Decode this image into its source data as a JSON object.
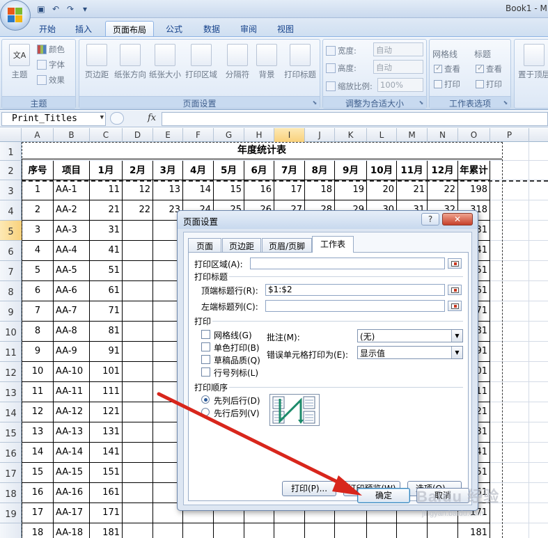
{
  "app": {
    "window_title": "Book1 - M",
    "qat": [
      "save-icon",
      "undo-icon",
      "redo-icon",
      "customize-icon"
    ]
  },
  "ribbon": {
    "tabs": [
      "开始",
      "插入",
      "页面布局",
      "公式",
      "数据",
      "审阅",
      "视图"
    ],
    "active_tab": "页面布局",
    "themes": {
      "label": "主题",
      "main": "主题",
      "colors": "颜色",
      "fonts": "字体",
      "effects": "效果"
    },
    "page_setup": {
      "label": "页面设置",
      "margins": "页边距",
      "orientation": "纸张方向",
      "size": "纸张大小",
      "print_area": "打印区域",
      "breaks": "分隔符",
      "background": "背景",
      "print_titles": "打印标题"
    },
    "scale_to_fit": {
      "label": "调整为合适大小",
      "width_label": "宽度:",
      "width_value": "自动",
      "height_label": "高度:",
      "height_value": "自动",
      "scale_label": "缩放比例:",
      "scale_value": "100%"
    },
    "sheet_options": {
      "label": "工作表选项",
      "gridlines": "网格线",
      "headings": "标题",
      "view": "查看",
      "print": "打印"
    },
    "arrange": {
      "bring_forward": "置于顶层"
    }
  },
  "formula_bar": {
    "name_box": "Print_Titles",
    "fx": "fx",
    "formula": ""
  },
  "sheet": {
    "columns": [
      "A",
      "B",
      "C",
      "D",
      "E",
      "F",
      "G",
      "H",
      "I",
      "J",
      "K",
      "L",
      "M",
      "N",
      "O",
      "P"
    ],
    "selected_column": "I",
    "rows": [
      "1",
      "2",
      "3",
      "4",
      "5",
      "6",
      "7",
      "8",
      "9",
      "10",
      "11",
      "12",
      "13",
      "14",
      "15",
      "16",
      "17",
      "18",
      "19"
    ],
    "selected_row": "5",
    "title": "年度统计表",
    "header": [
      "序号",
      "项目",
      "1月",
      "2月",
      "3月",
      "4月",
      "5月",
      "6月",
      "7月",
      "8月",
      "9月",
      "10月",
      "11月",
      "12月",
      "年累计"
    ],
    "data": [
      [
        "1",
        "AA-1",
        "11",
        "12",
        "13",
        "14",
        "15",
        "16",
        "17",
        "18",
        "19",
        "20",
        "21",
        "22",
        "198"
      ],
      [
        "2",
        "AA-2",
        "21",
        "22",
        "23",
        "24",
        "25",
        "26",
        "27",
        "28",
        "29",
        "30",
        "31",
        "32",
        "318"
      ],
      [
        "3",
        "AA-3",
        "31",
        "",
        "",
        "",
        "",
        "",
        "",
        "",
        "",
        "",
        "",
        "",
        "31"
      ],
      [
        "4",
        "AA-4",
        "41",
        "",
        "",
        "",
        "",
        "",
        "",
        "",
        "",
        "",
        "",
        "",
        "41"
      ],
      [
        "5",
        "AA-5",
        "51",
        "",
        "",
        "",
        "",
        "",
        "",
        "",
        "",
        "",
        "",
        "",
        "51"
      ],
      [
        "6",
        "AA-6",
        "61",
        "",
        "",
        "",
        "",
        "",
        "",
        "",
        "",
        "",
        "",
        "",
        "61"
      ],
      [
        "7",
        "AA-7",
        "71",
        "",
        "",
        "",
        "",
        "",
        "",
        "",
        "",
        "",
        "",
        "",
        "71"
      ],
      [
        "8",
        "AA-8",
        "81",
        "",
        "",
        "",
        "",
        "",
        "",
        "",
        "",
        "",
        "",
        "",
        "81"
      ],
      [
        "9",
        "AA-9",
        "91",
        "",
        "",
        "",
        "",
        "",
        "",
        "",
        "",
        "",
        "",
        "",
        "91"
      ],
      [
        "10",
        "AA-10",
        "101",
        "",
        "",
        "",
        "",
        "",
        "",
        "",
        "",
        "",
        "",
        "",
        "101"
      ],
      [
        "11",
        "AA-11",
        "111",
        "",
        "",
        "",
        "",
        "",
        "",
        "",
        "",
        "",
        "",
        "",
        "111"
      ],
      [
        "12",
        "AA-12",
        "121",
        "",
        "",
        "",
        "",
        "",
        "",
        "",
        "",
        "",
        "",
        "",
        "121"
      ],
      [
        "13",
        "AA-13",
        "131",
        "",
        "",
        "",
        "",
        "",
        "",
        "",
        "",
        "",
        "",
        "",
        "131"
      ],
      [
        "14",
        "AA-14",
        "141",
        "",
        "",
        "",
        "",
        "",
        "",
        "",
        "",
        "",
        "",
        "",
        "141"
      ],
      [
        "15",
        "AA-15",
        "151",
        "",
        "",
        "",
        "",
        "",
        "",
        "",
        "",
        "",
        "",
        "",
        "151"
      ],
      [
        "16",
        "AA-16",
        "161",
        "",
        "",
        "",
        "",
        "",
        "",
        "",
        "",
        "",
        "",
        "",
        "161"
      ],
      [
        "17",
        "AA-17",
        "171",
        "",
        "",
        "",
        "",
        "",
        "",
        "",
        "",
        "",
        "",
        "",
        "171"
      ],
      [
        "18",
        "AA-18",
        "181",
        "",
        "",
        "",
        "",
        "",
        "",
        "",
        "",
        "",
        "",
        "",
        "181"
      ]
    ]
  },
  "dialog": {
    "title": "页面设置",
    "help": "?",
    "close": "✕",
    "tabs": [
      "页面",
      "页边距",
      "页眉/页脚",
      "工作表"
    ],
    "active_tab": "工作表",
    "print_area_label": "打印区域(A):",
    "print_area_value": "",
    "print_titles_label": "打印标题",
    "rows_to_repeat_label": "顶端标题行(R):",
    "rows_to_repeat_value": "$1:$2",
    "cols_to_repeat_label": "左端标题列(C):",
    "cols_to_repeat_value": "",
    "print_section_label": "打印",
    "gridlines_label": "网格线(G)",
    "bw_label": "单色打印(B)",
    "draft_label": "草稿品质(Q)",
    "headings_label": "行号列标(L)",
    "comments_label": "批注(M):",
    "comments_value": "(无)",
    "errors_label": "错误单元格打印为(E):",
    "errors_value": "显示值",
    "order_label": "打印顺序",
    "down_then_over": "先列后行(D)",
    "over_then_down": "先行后列(V)",
    "print_btn": "打印(P)...",
    "preview_btn": "打印预览(W)",
    "options_btn": "选项(O)...",
    "ok_btn": "确定",
    "cancel_btn": "取消"
  },
  "overlay": {
    "watermark": "Baidu 经验",
    "watermark_url": "jingyan.baidu.com",
    "arrow_color": "#d8261c"
  }
}
